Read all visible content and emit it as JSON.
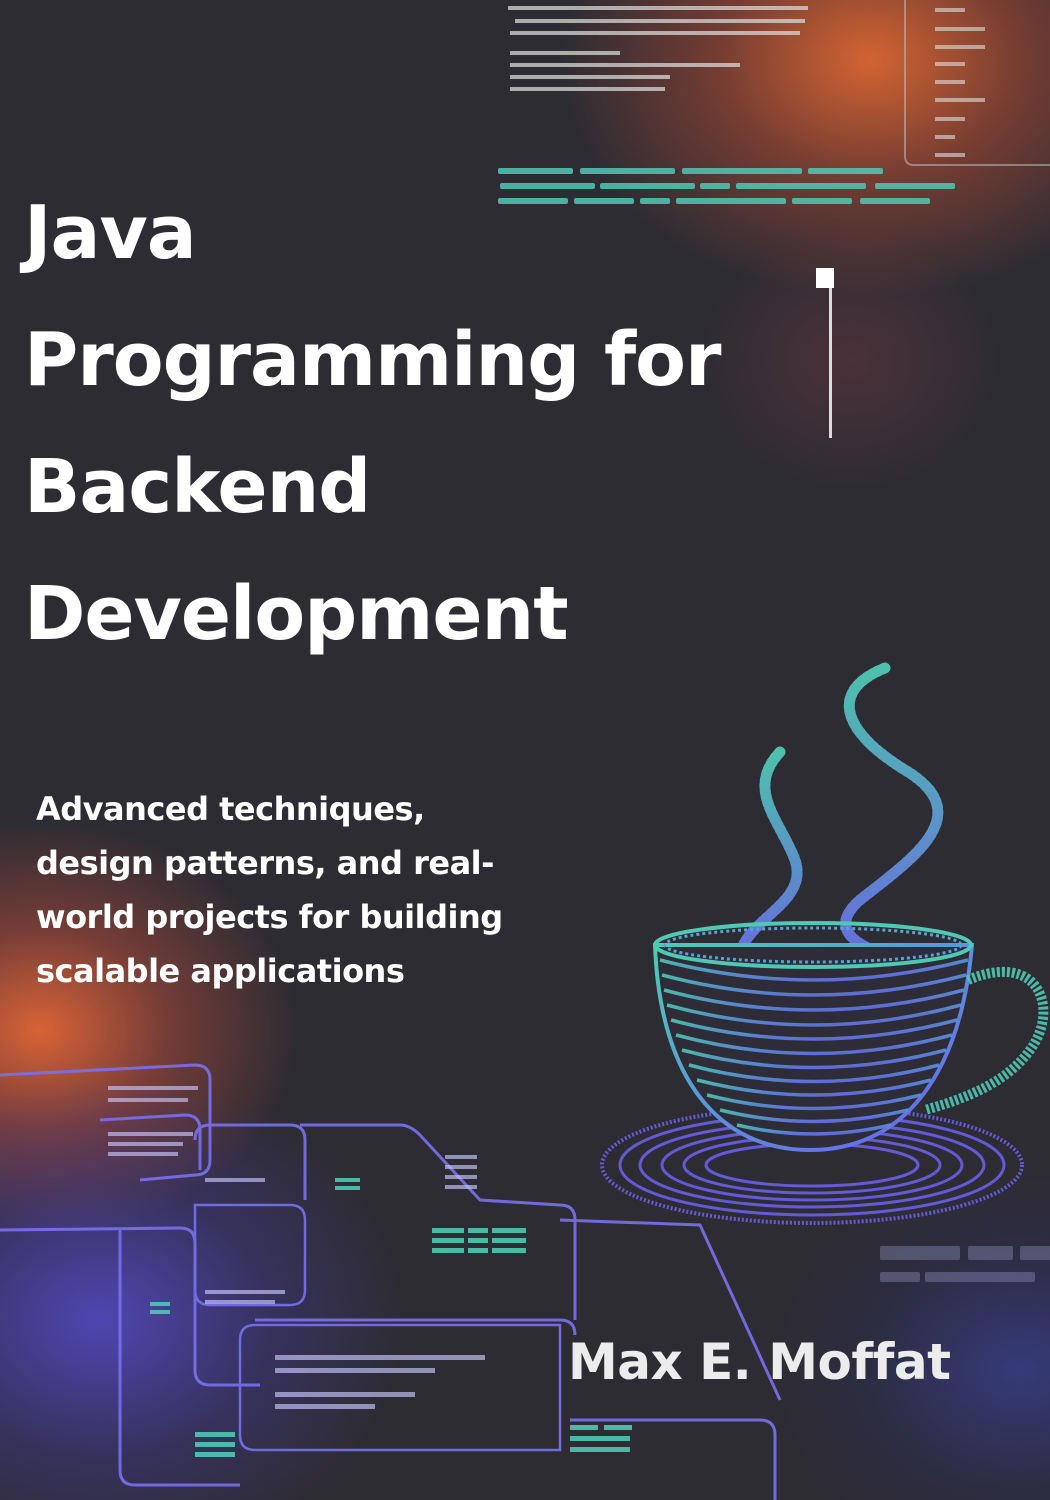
{
  "cover": {
    "title_lines": [
      "Java",
      "Programming for",
      "Backend",
      "Development"
    ],
    "subtitle_lines": [
      "Advanced techniques,",
      "design patterns, and real-",
      "world projects for building",
      "scalable applications"
    ],
    "author": "Max E. Moffat"
  },
  "colors": {
    "background": "#2e2c33",
    "text": "#ffffff",
    "accent_orange": "#f06e32",
    "accent_teal": "#4fc9b4",
    "accent_blue": "#6a5ee8"
  },
  "icons": [
    "coffee-cup-icon",
    "steam-icon",
    "circuit-board-graphic",
    "code-screen-graphic"
  ]
}
